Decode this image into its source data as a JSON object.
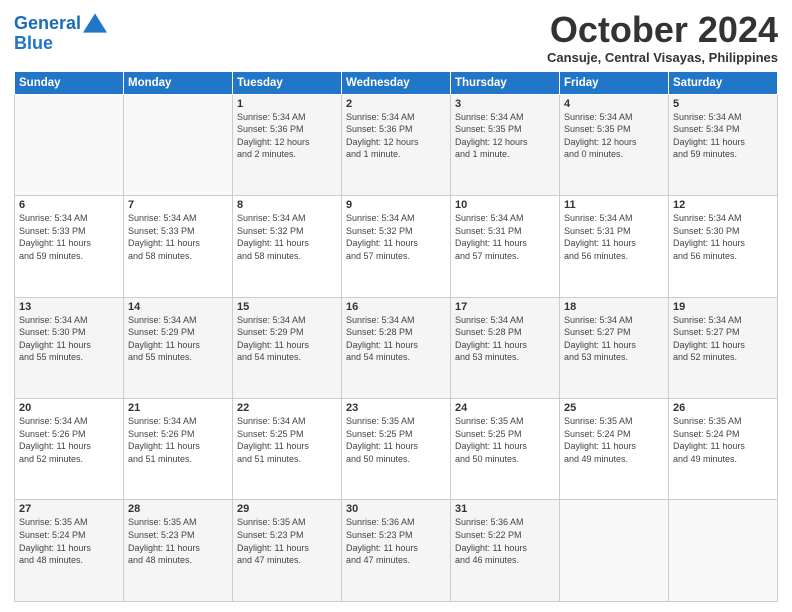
{
  "header": {
    "logo_line1": "General",
    "logo_line2": "Blue",
    "month": "October 2024",
    "location": "Cansuje, Central Visayas, Philippines"
  },
  "days_of_week": [
    "Sunday",
    "Monday",
    "Tuesday",
    "Wednesday",
    "Thursday",
    "Friday",
    "Saturday"
  ],
  "weeks": [
    [
      {
        "day": "",
        "info": ""
      },
      {
        "day": "",
        "info": ""
      },
      {
        "day": "1",
        "info": "Sunrise: 5:34 AM\nSunset: 5:36 PM\nDaylight: 12 hours\nand 2 minutes."
      },
      {
        "day": "2",
        "info": "Sunrise: 5:34 AM\nSunset: 5:36 PM\nDaylight: 12 hours\nand 1 minute."
      },
      {
        "day": "3",
        "info": "Sunrise: 5:34 AM\nSunset: 5:35 PM\nDaylight: 12 hours\nand 1 minute."
      },
      {
        "day": "4",
        "info": "Sunrise: 5:34 AM\nSunset: 5:35 PM\nDaylight: 12 hours\nand 0 minutes."
      },
      {
        "day": "5",
        "info": "Sunrise: 5:34 AM\nSunset: 5:34 PM\nDaylight: 11 hours\nand 59 minutes."
      }
    ],
    [
      {
        "day": "6",
        "info": "Sunrise: 5:34 AM\nSunset: 5:33 PM\nDaylight: 11 hours\nand 59 minutes."
      },
      {
        "day": "7",
        "info": "Sunrise: 5:34 AM\nSunset: 5:33 PM\nDaylight: 11 hours\nand 58 minutes."
      },
      {
        "day": "8",
        "info": "Sunrise: 5:34 AM\nSunset: 5:32 PM\nDaylight: 11 hours\nand 58 minutes."
      },
      {
        "day": "9",
        "info": "Sunrise: 5:34 AM\nSunset: 5:32 PM\nDaylight: 11 hours\nand 57 minutes."
      },
      {
        "day": "10",
        "info": "Sunrise: 5:34 AM\nSunset: 5:31 PM\nDaylight: 11 hours\nand 57 minutes."
      },
      {
        "day": "11",
        "info": "Sunrise: 5:34 AM\nSunset: 5:31 PM\nDaylight: 11 hours\nand 56 minutes."
      },
      {
        "day": "12",
        "info": "Sunrise: 5:34 AM\nSunset: 5:30 PM\nDaylight: 11 hours\nand 56 minutes."
      }
    ],
    [
      {
        "day": "13",
        "info": "Sunrise: 5:34 AM\nSunset: 5:30 PM\nDaylight: 11 hours\nand 55 minutes."
      },
      {
        "day": "14",
        "info": "Sunrise: 5:34 AM\nSunset: 5:29 PM\nDaylight: 11 hours\nand 55 minutes."
      },
      {
        "day": "15",
        "info": "Sunrise: 5:34 AM\nSunset: 5:29 PM\nDaylight: 11 hours\nand 54 minutes."
      },
      {
        "day": "16",
        "info": "Sunrise: 5:34 AM\nSunset: 5:28 PM\nDaylight: 11 hours\nand 54 minutes."
      },
      {
        "day": "17",
        "info": "Sunrise: 5:34 AM\nSunset: 5:28 PM\nDaylight: 11 hours\nand 53 minutes."
      },
      {
        "day": "18",
        "info": "Sunrise: 5:34 AM\nSunset: 5:27 PM\nDaylight: 11 hours\nand 53 minutes."
      },
      {
        "day": "19",
        "info": "Sunrise: 5:34 AM\nSunset: 5:27 PM\nDaylight: 11 hours\nand 52 minutes."
      }
    ],
    [
      {
        "day": "20",
        "info": "Sunrise: 5:34 AM\nSunset: 5:26 PM\nDaylight: 11 hours\nand 52 minutes."
      },
      {
        "day": "21",
        "info": "Sunrise: 5:34 AM\nSunset: 5:26 PM\nDaylight: 11 hours\nand 51 minutes."
      },
      {
        "day": "22",
        "info": "Sunrise: 5:34 AM\nSunset: 5:25 PM\nDaylight: 11 hours\nand 51 minutes."
      },
      {
        "day": "23",
        "info": "Sunrise: 5:35 AM\nSunset: 5:25 PM\nDaylight: 11 hours\nand 50 minutes."
      },
      {
        "day": "24",
        "info": "Sunrise: 5:35 AM\nSunset: 5:25 PM\nDaylight: 11 hours\nand 50 minutes."
      },
      {
        "day": "25",
        "info": "Sunrise: 5:35 AM\nSunset: 5:24 PM\nDaylight: 11 hours\nand 49 minutes."
      },
      {
        "day": "26",
        "info": "Sunrise: 5:35 AM\nSunset: 5:24 PM\nDaylight: 11 hours\nand 49 minutes."
      }
    ],
    [
      {
        "day": "27",
        "info": "Sunrise: 5:35 AM\nSunset: 5:24 PM\nDaylight: 11 hours\nand 48 minutes."
      },
      {
        "day": "28",
        "info": "Sunrise: 5:35 AM\nSunset: 5:23 PM\nDaylight: 11 hours\nand 48 minutes."
      },
      {
        "day": "29",
        "info": "Sunrise: 5:35 AM\nSunset: 5:23 PM\nDaylight: 11 hours\nand 47 minutes."
      },
      {
        "day": "30",
        "info": "Sunrise: 5:36 AM\nSunset: 5:23 PM\nDaylight: 11 hours\nand 47 minutes."
      },
      {
        "day": "31",
        "info": "Sunrise: 5:36 AM\nSunset: 5:22 PM\nDaylight: 11 hours\nand 46 minutes."
      },
      {
        "day": "",
        "info": ""
      },
      {
        "day": "",
        "info": ""
      }
    ]
  ]
}
